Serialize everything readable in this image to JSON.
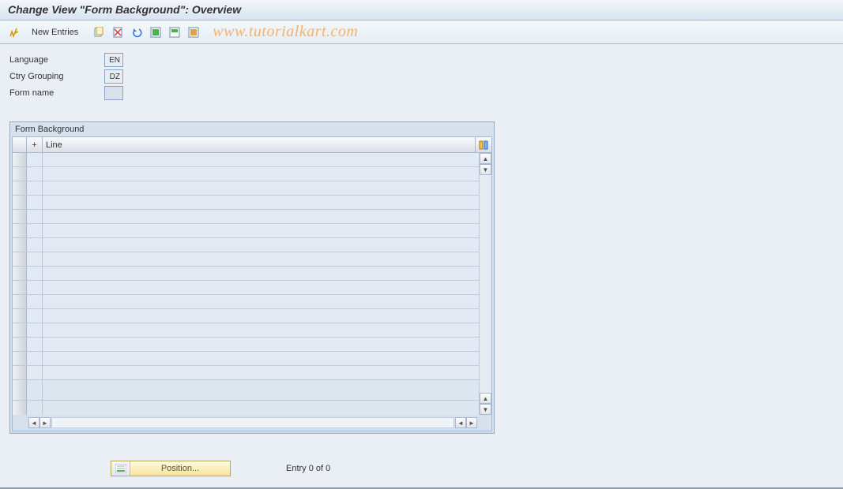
{
  "title": "Change View \"Form Background\": Overview",
  "toolbar": {
    "new_entries_label": "New Entries"
  },
  "watermark": "www.tutorialkart.com",
  "fields": {
    "language": {
      "label": "Language",
      "value": "EN"
    },
    "ctry_grouping": {
      "label": "Ctry Grouping",
      "value": "DZ"
    },
    "form_name": {
      "label": "Form name",
      "value": ""
    }
  },
  "panel": {
    "title": "Form Background",
    "columns": {
      "plus": "+",
      "line": "Line"
    }
  },
  "footer": {
    "position_label": "Position...",
    "entry_text": "Entry 0 of 0"
  }
}
